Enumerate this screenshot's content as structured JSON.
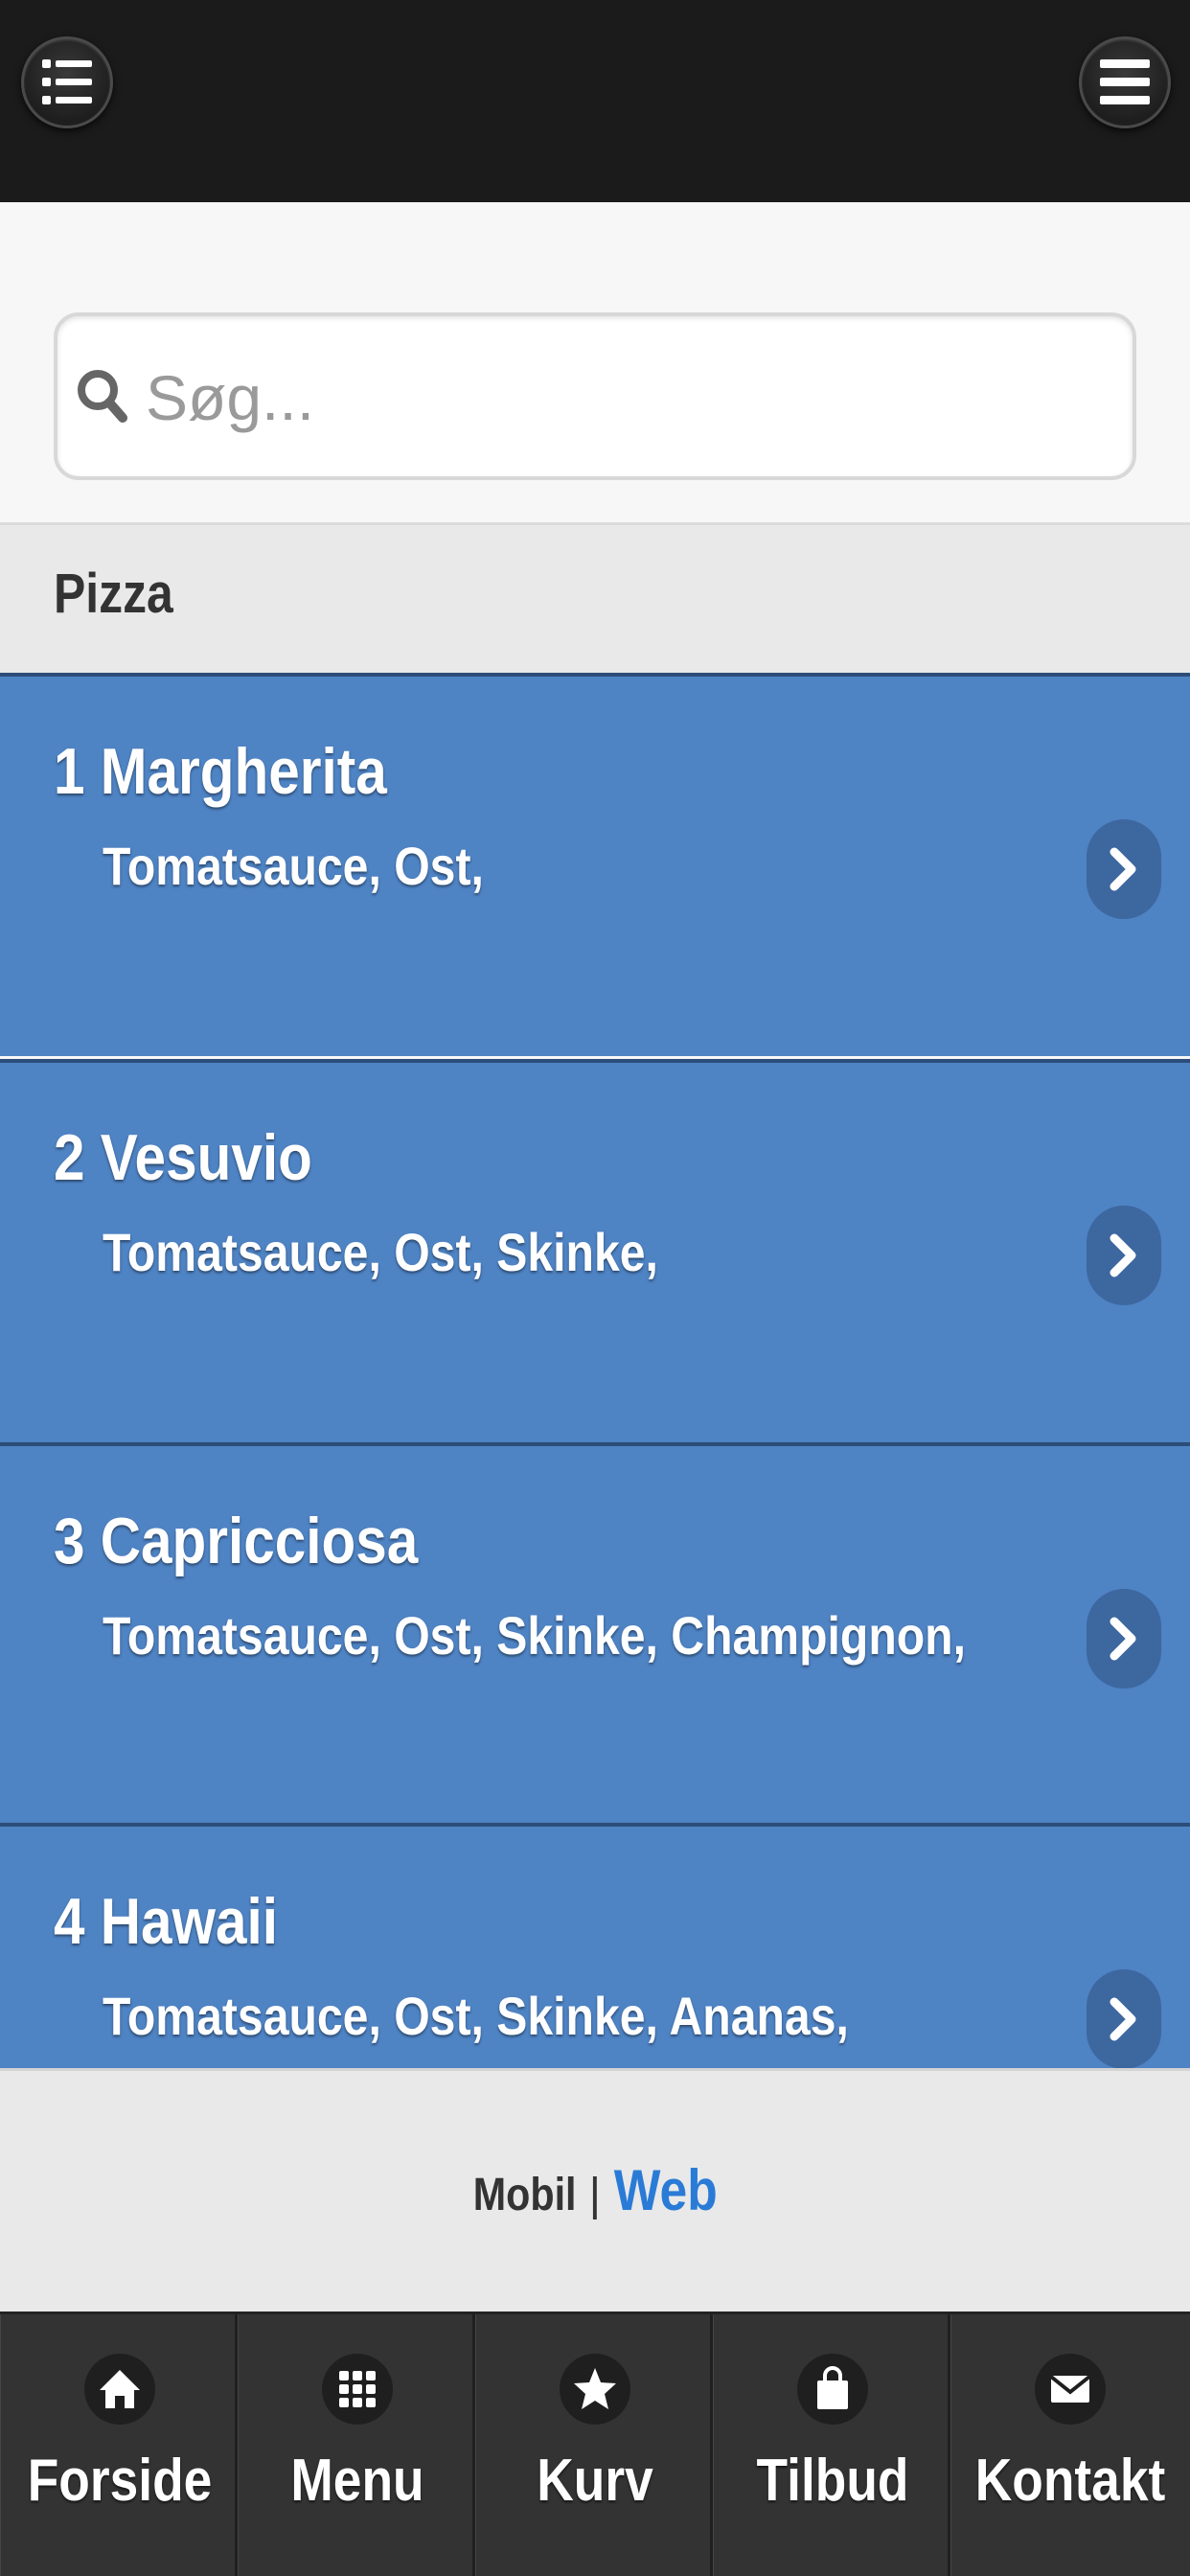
{
  "header": {
    "left_icon": "list-icon",
    "right_icon": "hamburger-menu-icon"
  },
  "search": {
    "placeholder": "Søg...",
    "icon": "search-icon"
  },
  "category": {
    "label": "Pizza"
  },
  "items": [
    {
      "title": "1 Margherita",
      "ingredients": "Tomatsauce, Ost,"
    },
    {
      "title": "2 Vesuvio",
      "ingredients": "Tomatsauce, Ost, Skinke,"
    },
    {
      "title": "3 Capricciosa",
      "ingredients": "Tomatsauce, Ost, Skinke, Champignon,"
    },
    {
      "title": "4 Hawaii",
      "ingredients": "Tomatsauce, Ost, Skinke, Ananas,"
    }
  ],
  "footer": {
    "mobile_label": "Mobil",
    "separator": "|",
    "web_label": "Web"
  },
  "tabs": [
    {
      "label": "Forside",
      "icon": "home-icon"
    },
    {
      "label": "Menu",
      "icon": "grid-icon"
    },
    {
      "label": "Kurv",
      "icon": "star-icon"
    },
    {
      "label": "Tilbud",
      "icon": "shopping-bag-icon"
    },
    {
      "label": "Kontakt",
      "icon": "envelope-icon"
    }
  ],
  "colors": {
    "header_bg": "#1b1b1b",
    "item_bg": "#4e83c4",
    "item_border": "#2c4d79",
    "link": "#2a7bd6",
    "tabbar_bg": "#333333"
  }
}
